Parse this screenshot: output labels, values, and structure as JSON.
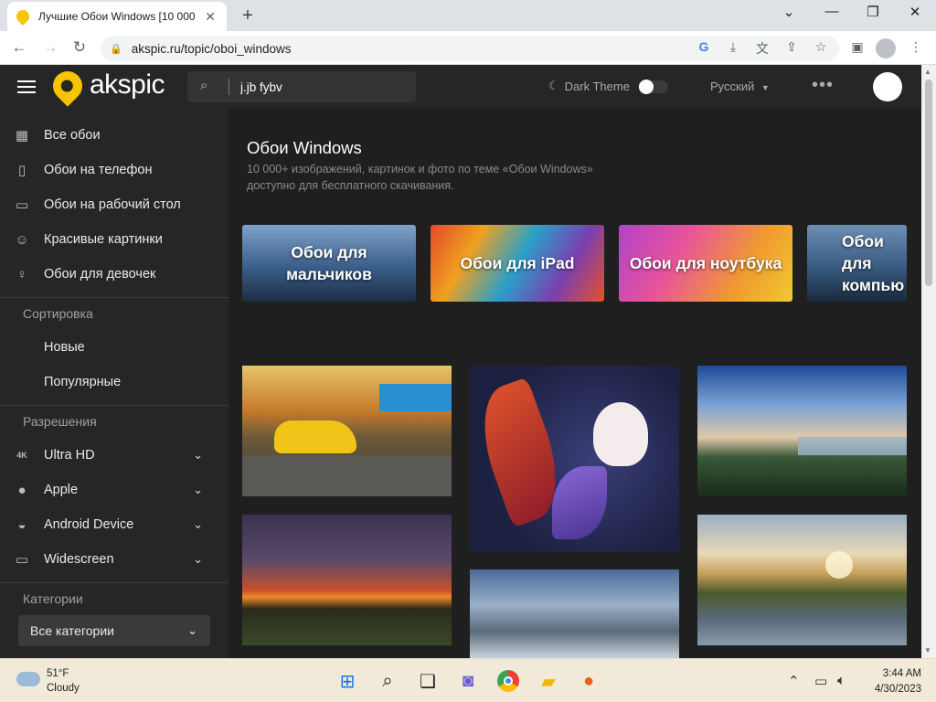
{
  "browser": {
    "tab_title": "Лучшие Обои Windows [10 000",
    "tab_close": "✕",
    "new_tab": "+",
    "url": "akspic.ru/topic/oboi_windows",
    "window_controls": [
      "⌄",
      "—",
      "❐",
      "✕"
    ],
    "nav_back": "←",
    "nav_forward": "→",
    "nav_reload": "↻",
    "lock_icon": "🔒"
  },
  "header": {
    "logo_text": "akspic",
    "search_value": "j.jb fybv",
    "dark_theme_label": "Dark Theme",
    "language": "Русский",
    "more": "•••"
  },
  "sidebar": {
    "main_items": [
      {
        "label": "Все обои",
        "icon": "grid-icon"
      },
      {
        "label": "Обои на телефон",
        "icon": "phone-icon"
      },
      {
        "label": "Обои на рабочий стол",
        "icon": "monitor-icon"
      },
      {
        "label": "Красивые картинки",
        "icon": "smile-icon"
      },
      {
        "label": "Обои для девочек",
        "icon": "girl-icon"
      }
    ],
    "sort_title": "Сортировка",
    "sort_items": [
      "Новые",
      "Популярные"
    ],
    "resolutions_title": "Разрешения",
    "resolution_items": [
      {
        "label": "Ultra HD",
        "icon": "4k-icon"
      },
      {
        "label": "Apple",
        "icon": "apple-icon"
      },
      {
        "label": "Android Device",
        "icon": "android-icon"
      },
      {
        "label": "Widescreen",
        "icon": "widescreen-icon"
      }
    ],
    "categories_title": "Категории",
    "categories_select": "Все категории"
  },
  "main": {
    "title": "Обои Windows",
    "description": "10 000+ изображений, картинок и фото по теме «Обои Windows» доступно для бесплатного скачивания.",
    "category_cards": [
      {
        "label": "Обои для мальчиков"
      },
      {
        "label": "Обои для iPad"
      },
      {
        "label": "Обои для ноутбука"
      },
      {
        "label": "Обои для компью"
      }
    ]
  },
  "taskbar": {
    "temperature": "51°F",
    "condition": "Cloudy",
    "time": "3:44 AM",
    "date": "4/30/2023"
  }
}
